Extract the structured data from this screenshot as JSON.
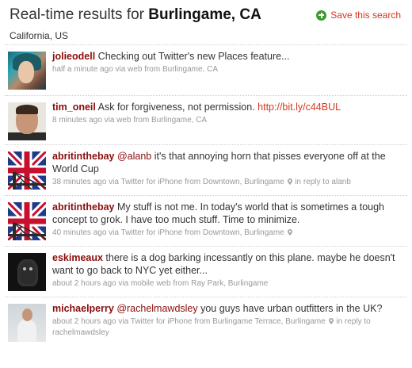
{
  "header": {
    "title_prefix": "Real-time results for ",
    "title_location": "Burlingame, CA",
    "subtitle": "California, US",
    "save_label": "Save this search"
  },
  "colors": {
    "username": "#8a0d0d",
    "link": "#d8351f",
    "meta": "#999999",
    "save_icon": "#3c9b2c"
  },
  "tweets": [
    {
      "user": "jolieodell",
      "text": "Checking out Twitter's new Places feature...",
      "meta": "half a minute ago via web from Burlingame, CA",
      "avatar": "woman-teal-hair-avatar"
    },
    {
      "user": "tim_oneil",
      "text": "Ask for forgiveness, not permission. ",
      "link": "http://bit.ly/c44BUL",
      "meta": "8 minutes ago via web from Burlingame, CA",
      "avatar": "man-portrait-avatar"
    },
    {
      "user": "abritinthebay",
      "mention": "@alanb",
      "text": " it's that annoying horn that pisses everyone off at the World Cup",
      "meta_prefix": "38 minutes ago via Twitter for iPhone from Downtown, Burlingame",
      "meta_suffix": "in reply to alanb",
      "avatar": "union-jack-bridge-avatar"
    },
    {
      "user": "abritinthebay",
      "text": "My stuff is not me. In today's world that is sometimes a tough concept to grok. I have too much stuff. Time to minimize.",
      "meta_prefix": "40 minutes ago via Twitter for iPhone from Downtown, Burlingame",
      "avatar": "union-jack-bridge-avatar"
    },
    {
      "user": "eskimeaux",
      "text": "there is a dog barking incessantly on this plane. maybe he doesn't want to go back to NYC yet either...",
      "meta": "about 2 hours ago via mobile web from Ray Park, Burlingame",
      "avatar": "dark-creature-avatar"
    },
    {
      "user": "michaelperry",
      "mention": "@rachelmawdsley",
      "text": " you guys have urban outfitters in the UK?",
      "meta_prefix": "about 2 hours ago via Twitter for iPhone from Burlingame Terrace, Burlingame",
      "meta_suffix": "in reply to rachelmawdsley",
      "avatar": "man-white-shirt-avatar"
    }
  ]
}
